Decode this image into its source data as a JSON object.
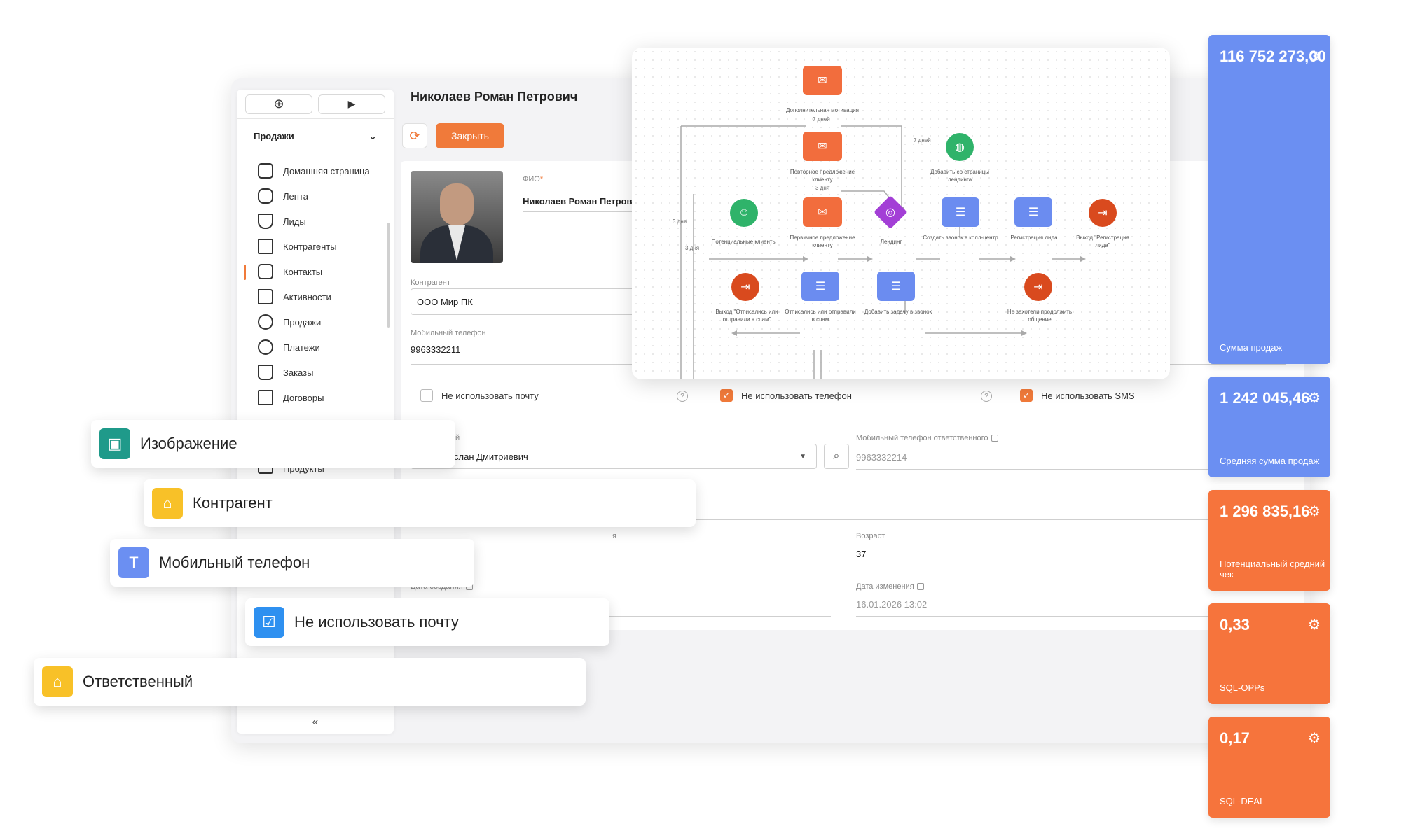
{
  "colors": {
    "accent": "#f07a3a",
    "kpi_blue": "#6b8ff2",
    "kpi_orange": "#f6743c",
    "chip_teal": "#1f9a8a",
    "chip_yellow": "#f8c128",
    "chip_blue": "#6b8ff2",
    "chip_check": "#2e90f0"
  },
  "sidebar": {
    "add_icon": "⊕",
    "play_icon": "▶",
    "section": "Продажи",
    "items": [
      {
        "label": "Домашняя страница",
        "icon": "home-icon"
      },
      {
        "label": "Лента",
        "icon": "chat-icon"
      },
      {
        "label": "Лиды",
        "icon": "funnel-icon"
      },
      {
        "label": "Контрагенты",
        "icon": "document-icon"
      },
      {
        "label": "Контакты",
        "icon": "contact-icon",
        "active": true
      },
      {
        "label": "Активности",
        "icon": "flag-icon"
      },
      {
        "label": "Продажи",
        "icon": "coins-icon"
      },
      {
        "label": "Платежи",
        "icon": "payment-icon"
      },
      {
        "label": "Заказы",
        "icon": "cart-icon"
      },
      {
        "label": "Договоры",
        "icon": "contract-icon"
      }
    ],
    "products_label": "Продукты",
    "collapse": "«"
  },
  "header": {
    "title": "Николаев Роман Петрович",
    "close_label": "Закрыть",
    "refresh_icon": "⟳"
  },
  "form": {
    "fio_label": "ФИО",
    "fio_required": "*",
    "fio_value": "Николаев Роман Петров",
    "counterparty_label": "Контрагент",
    "counterparty_value": "ООО Мир ПК",
    "mobile_label": "Мобильный телефон",
    "mobile_value": "9963332211",
    "no_email": "Не использовать почту",
    "no_phone": "Не использовать телефон",
    "no_sms": "Не использовать SMS",
    "help": "?",
    "responsible_label": "нный",
    "responsible_value": "Руслан Дмитриевич",
    "resp_phone_label": "Мобильный телефон ответственного",
    "resp_phone_value": "9963332214",
    "age_label": "Возраст",
    "age_value": "37",
    "created_label": "Дата создания",
    "modified_label": "Дата изменения",
    "modified_value": "16.01.2026 13:02",
    "partial_label": "я"
  },
  "flow": {
    "nodes": {
      "extra_motivation": "Дополнительная мотивация",
      "repeat_offer": "Повторное предложение клиенту",
      "first_offer": "Первичное предложение клиенту",
      "potential": "Потенциальные клиенты",
      "landing": "Лендинг",
      "from_landing": "Добавить со страницы лендинга",
      "create_call": "Создать звонок в колл-центр",
      "register_lead": "Регистрация лида",
      "exit_register": "Выход \"Регистрация лида\"",
      "exit_unsub": "Выход \"Отписались или отправили в спам\"",
      "unsub": "Отписались или отправили в спам",
      "add_task": "Добавить задачу в звонок",
      "not_continue": "Не захотели продолжить общение"
    },
    "days": {
      "d7": "7 дней",
      "d7b": "7 дней",
      "d3": "3 дня",
      "d3a": "3 дня",
      "d3b": "3 дня"
    }
  },
  "kpis": [
    {
      "value": "116 752 273,00",
      "label": "Сумма продаж",
      "color": "blue"
    },
    {
      "value": "1 242 045,46",
      "label": "Средняя сумма продаж",
      "color": "blue"
    },
    {
      "value": "1 296 835,16",
      "label": "Потенциальный средний чек",
      "color": "orange"
    },
    {
      "value": "0,33",
      "label": "SQL-OPPs",
      "color": "orange"
    },
    {
      "value": "0,17",
      "label": "SQL-DEAL",
      "color": "orange"
    }
  ],
  "chips": [
    {
      "label": "Изображение",
      "icon": "image-icon"
    },
    {
      "label": "Контрагент",
      "icon": "lookup-icon"
    },
    {
      "label": "Мобильный телефон",
      "icon": "text-icon",
      "glyph": "T"
    },
    {
      "label": "Не использовать почту",
      "icon": "checkbox-icon",
      "glyph": "☑"
    },
    {
      "label": "Ответственный",
      "icon": "lookup-icon"
    }
  ]
}
